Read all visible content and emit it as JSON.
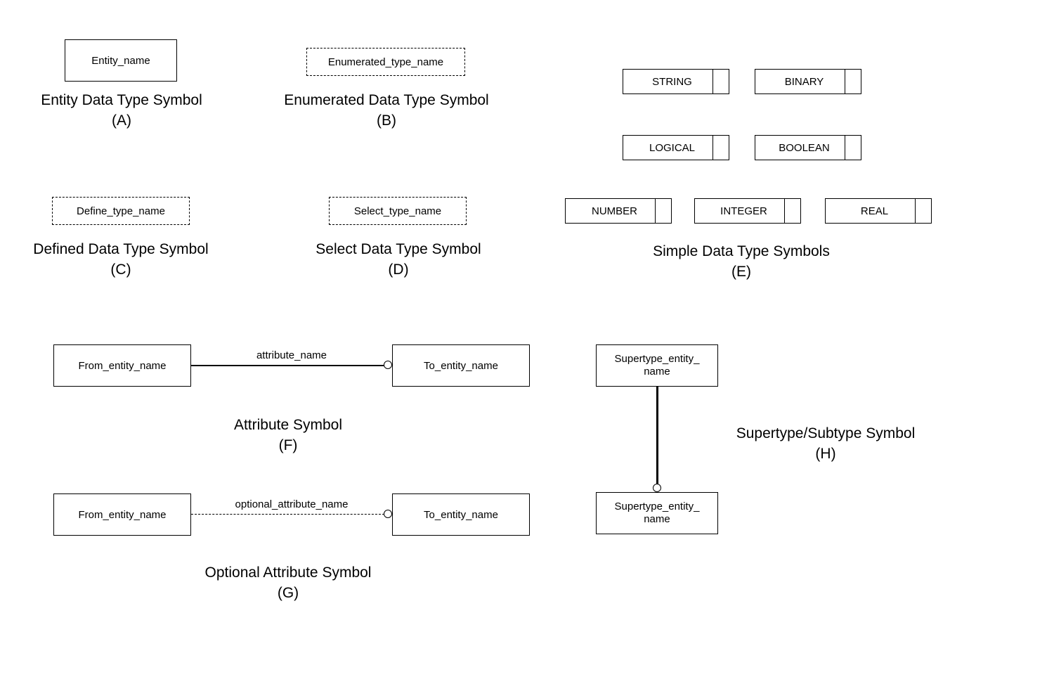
{
  "symbols": {
    "a": {
      "label": "Entity_name",
      "caption": "Entity Data Type Symbol",
      "letter": "(A)"
    },
    "b": {
      "label": "Enumerated_type_name",
      "caption": "Enumerated Data Type Symbol",
      "letter": "(B)"
    },
    "c": {
      "label": "Define_type_name",
      "caption": "Defined Data Type Symbol",
      "letter": "(C)"
    },
    "d": {
      "label": "Select_type_name",
      "caption": "Select Data Type Symbol",
      "letter": "(D)"
    },
    "e": {
      "caption": "Simple Data Type Symbols",
      "letter": "(E)",
      "types": [
        "STRING",
        "BINARY",
        "LOGICAL",
        "BOOLEAN",
        "NUMBER",
        "INTEGER",
        "REAL"
      ]
    },
    "f": {
      "from": "From_entity_name",
      "to": "To_entity_name",
      "attr": "attribute_name",
      "caption": "Attribute Symbol",
      "letter": "(F)"
    },
    "g": {
      "from": "From_entity_name",
      "to": "To_entity_name",
      "attr": "optional_attribute_name",
      "caption": "Optional Attribute Symbol",
      "letter": "(G)"
    },
    "h": {
      "super": "Supertype_entity_\nname",
      "sub": "Supertype_entity_\nname",
      "caption": "Supertype/Subtype Symbol",
      "letter": "(H)"
    }
  }
}
